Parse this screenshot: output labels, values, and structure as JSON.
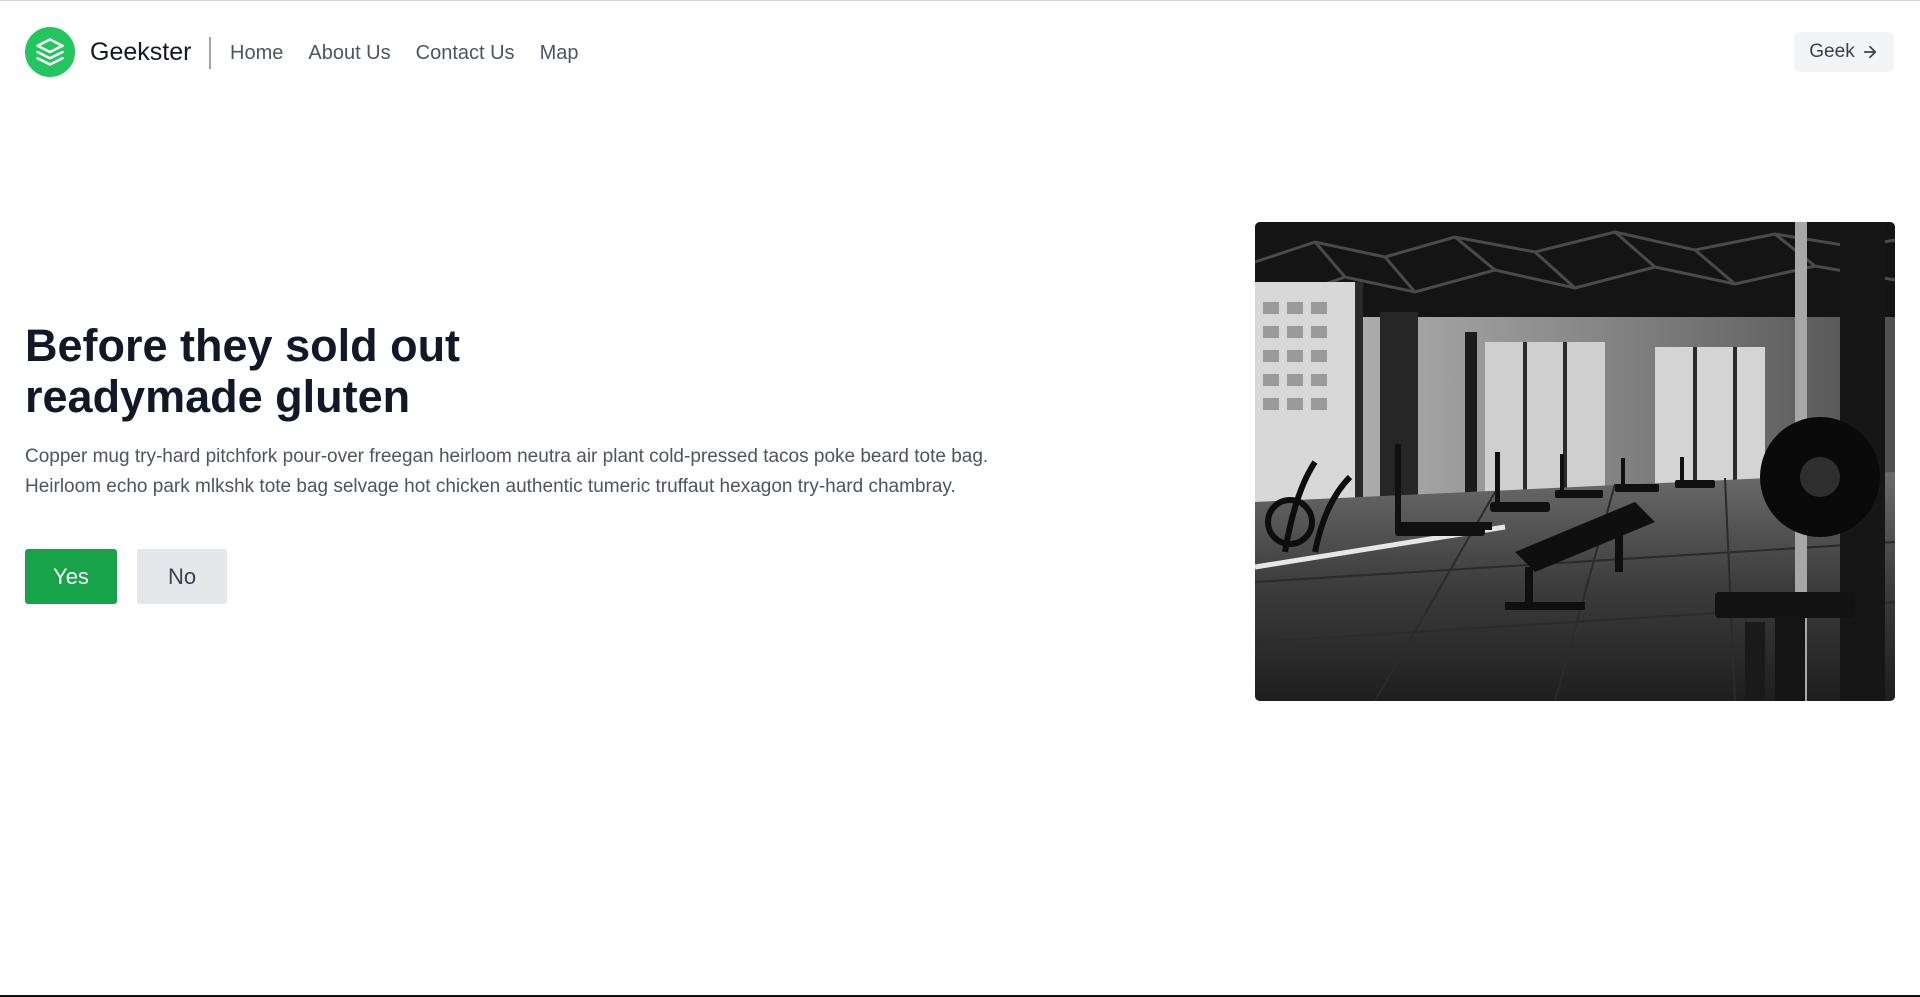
{
  "header": {
    "brand": "Geekster",
    "nav": [
      "Home",
      "About Us",
      "Contact Us",
      "Map"
    ],
    "cta_label": "Geek",
    "cta_icon": "arrow-right-icon",
    "logo_icon": "stack-layers-icon",
    "accent_color": "#22c55e"
  },
  "hero": {
    "title_lines": [
      "Before they sold out",
      "readymade gluten"
    ],
    "description_lines": [
      "Copper mug try-hard pitchfork pour-over freegan heirloom neutra air plant cold-pressed tacos poke beard tote bag.",
      "Heirloom echo park mlkshk tote bag selvage hot chicken authentic tumeric truffaut hexagon try-hard chambray."
    ],
    "primary_button": "Yes",
    "secondary_button": "No",
    "primary_color": "#16a34a"
  }
}
